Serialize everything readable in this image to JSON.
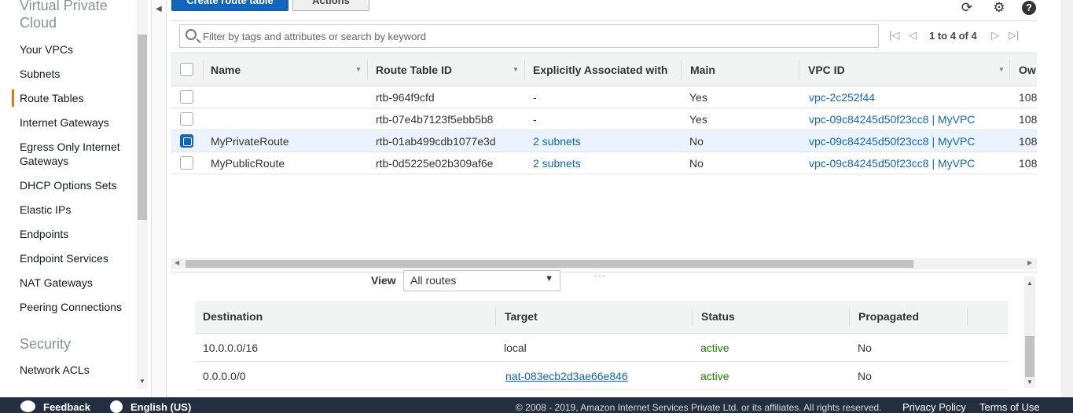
{
  "sidebar": {
    "section_vpc": "Virtual Private\nCloud",
    "items": [
      {
        "label": "Your VPCs"
      },
      {
        "label": "Subnets"
      },
      {
        "label": "Route Tables"
      },
      {
        "label": "Internet Gateways"
      },
      {
        "label": "Egress Only Internet Gateways"
      },
      {
        "label": "DHCP Options Sets"
      },
      {
        "label": "Elastic IPs"
      },
      {
        "label": "Endpoints"
      },
      {
        "label": "Endpoint Services"
      },
      {
        "label": "NAT Gateways"
      },
      {
        "label": "Peering Connections"
      }
    ],
    "section_security": "Security",
    "security_items": [
      {
        "label": "Network ACLs"
      }
    ],
    "active_item": "Route Tables"
  },
  "toolbar": {
    "create_label": "Create route table",
    "actions_label": "Actions",
    "icons": [
      "refresh-icon",
      "gear-icon",
      "help-icon"
    ]
  },
  "filter": {
    "placeholder": "Filter by tags and attributes or search by keyword",
    "pager_text": "1 to 4 of 4"
  },
  "table": {
    "columns": [
      "Name",
      "Route Table ID",
      "Explicitly Associated with",
      "Main",
      "VPC ID",
      "Ow"
    ],
    "rows": [
      {
        "name": "",
        "id": "rtb-964f9cfd",
        "assoc": "-",
        "main": "Yes",
        "vpc": "vpc-2c252f44",
        "owner": "108",
        "selected": false
      },
      {
        "name": "",
        "id": "rtb-07e4b7123f5ebb5b8",
        "assoc": "-",
        "main": "Yes",
        "vpc": "vpc-09c84245d50f23cc8 | MyVPC",
        "owner": "108",
        "selected": false
      },
      {
        "name": "MyPrivateRoute",
        "id": "rtb-01ab499cdb1077e3d",
        "assoc": "2 subnets",
        "main": "No",
        "vpc": "vpc-09c84245d50f23cc8 | MyVPC",
        "owner": "108",
        "selected": true
      },
      {
        "name": "MyPublicRoute",
        "id": "rtb-0d5225e02b309af6e",
        "assoc": "2 subnets",
        "main": "No",
        "vpc": "vpc-09c84245d50f23cc8 | MyVPC",
        "owner": "108",
        "selected": false
      }
    ]
  },
  "routes": {
    "view_label": "View",
    "view_value": "All routes",
    "columns": [
      "Destination",
      "Target",
      "Status",
      "Propagated"
    ],
    "rows": [
      {
        "destination": "10.0.0.0/16",
        "target": "local",
        "status": "active",
        "propagated": "No"
      },
      {
        "destination": "0.0.0.0/0",
        "target": "nat-083ecb2d3ae66e846",
        "status": "active",
        "propagated": "No"
      }
    ]
  },
  "footer": {
    "feedback": "Feedback",
    "language": "English (US)",
    "copyright": "© 2008 - 2019, Amazon Internet Services Private Ltd. or its affiliates. All rights reserved.",
    "privacy": "Privacy Policy",
    "terms": "Terms of Use"
  },
  "colors": {
    "accent": "#ec7211",
    "link": "#1166bb",
    "active_status": "#1d8102",
    "footer_bg": "#232f3e"
  }
}
